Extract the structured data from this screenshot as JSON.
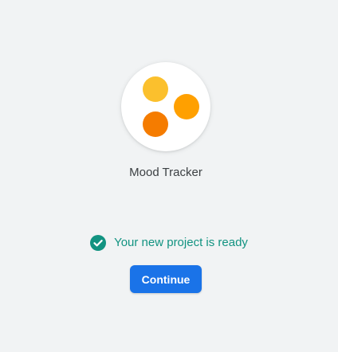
{
  "project": {
    "name": "Mood Tracker",
    "logo_icon": "three-dots-logo-icon",
    "logo_colors": [
      "#fbc02d",
      "#ffa000",
      "#f57c00"
    ]
  },
  "status": {
    "icon": "check-circle-icon",
    "message": "Your new project is ready",
    "color": "#129381"
  },
  "actions": {
    "continue_label": "Continue",
    "button_color": "#1a73e8"
  },
  "colors": {
    "background": "#f1f3f4"
  }
}
